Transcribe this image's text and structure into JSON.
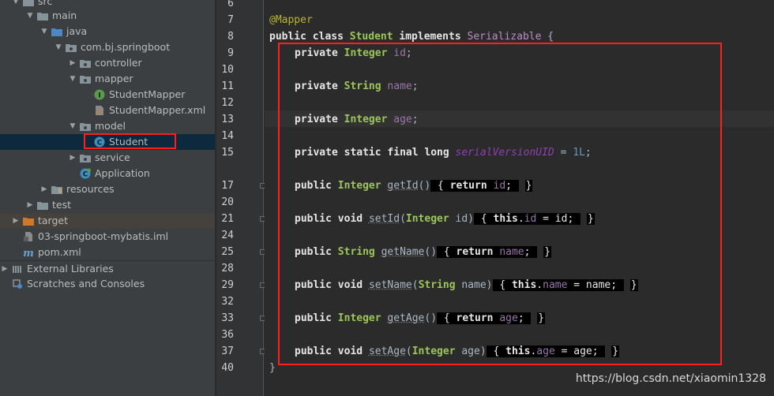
{
  "project_tree": {
    "items": [
      {
        "label": "src",
        "icon": "folder-icon",
        "arrow": "expanded"
      },
      {
        "label": "main",
        "icon": "folder-icon",
        "arrow": "expanded"
      },
      {
        "label": "java",
        "icon": "source-folder-icon",
        "arrow": "expanded"
      },
      {
        "label": "com.bj.springboot",
        "icon": "package-icon",
        "arrow": "expanded"
      },
      {
        "label": "controller",
        "icon": "package-icon",
        "arrow": "collapsed"
      },
      {
        "label": "mapper",
        "icon": "package-icon",
        "arrow": "expanded"
      },
      {
        "label": "StudentMapper",
        "icon": "interface-icon",
        "arrow": "none"
      },
      {
        "label": "StudentMapper.xml",
        "icon": "xml-file-icon",
        "arrow": "none"
      },
      {
        "label": "model",
        "icon": "package-icon",
        "arrow": "expanded"
      },
      {
        "label": "Student",
        "icon": "class-icon",
        "arrow": "none"
      },
      {
        "label": "service",
        "icon": "package-icon",
        "arrow": "collapsed"
      },
      {
        "label": "Application",
        "icon": "spring-boot-class-icon",
        "arrow": "none"
      },
      {
        "label": "resources",
        "icon": "resources-folder-icon",
        "arrow": "collapsed"
      },
      {
        "label": "test",
        "icon": "folder-icon",
        "arrow": "collapsed"
      },
      {
        "label": "target",
        "icon": "excluded-folder-icon",
        "arrow": "collapsed"
      },
      {
        "label": "03-springboot-mybatis.iml",
        "icon": "iml-file-icon",
        "arrow": "none"
      },
      {
        "label": "pom.xml",
        "icon": "maven-icon",
        "arrow": "none"
      },
      {
        "label": "External Libraries",
        "icon": "library-icon",
        "arrow": "collapsed"
      },
      {
        "label": "Scratches and Consoles",
        "icon": "scratches-icon",
        "arrow": "none"
      }
    ],
    "selected": "Student"
  },
  "editor": {
    "line_numbers": [
      "6",
      "7",
      "8",
      "9",
      "10",
      "11",
      "12",
      "13",
      "14",
      "15",
      "17",
      "20",
      "21",
      "24",
      "25",
      "28",
      "29",
      "32",
      "33",
      "36",
      "37",
      "40"
    ],
    "annotation": "@Mapper",
    "class_decl": {
      "k1": "public",
      "k2": "class",
      "name": "Student",
      "k3": "implements",
      "iface": "Serializable",
      "brace": "{"
    },
    "fields": [
      {
        "k1": "private",
        "type": "Integer",
        "name": "id",
        "end": ";"
      },
      {
        "k1": "private",
        "type": "String",
        "name": "name",
        "end": ";"
      },
      {
        "k1": "private",
        "type": "Integer",
        "name": "age",
        "end": ";"
      }
    ],
    "serial": {
      "k1": "private",
      "k2": "static",
      "k3": "final",
      "k4": "long",
      "name": "serialVersionUID",
      "eq": "=",
      "value": "1L",
      "end": ";"
    },
    "getters": [
      {
        "k1": "public",
        "type": "Integer",
        "method": "getId",
        "parens": "()",
        "open": "{",
        "ret": "return",
        "field": "id",
        "semi": ";",
        "close": "}"
      },
      {
        "k1": "public",
        "type": "String",
        "method": "getName",
        "parens": "()",
        "open": "{",
        "ret": "return",
        "field": "name",
        "semi": ";",
        "close": "}"
      },
      {
        "k1": "public",
        "type": "Integer",
        "method": "getAge",
        "parens": "()",
        "open": "{",
        "ret": "return",
        "field": "age",
        "semi": ";",
        "close": "}"
      }
    ],
    "setters": [
      {
        "k1": "public",
        "k2": "void",
        "method": "setId",
        "lp": "(",
        "ptype": "Integer",
        "param": "id",
        "rp": ")",
        "open": "{",
        "this": "this",
        "dot": ".",
        "field": "id",
        "eq": "=",
        "val": "id",
        "semi": ";",
        "close": "}"
      },
      {
        "k1": "public",
        "k2": "void",
        "method": "setName",
        "lp": "(",
        "ptype": "String",
        "param": "name",
        "rp": ")",
        "open": "{",
        "this": "this",
        "dot": ".",
        "field": "name",
        "eq": "=",
        "val": "name",
        "semi": ";",
        "close": "}"
      },
      {
        "k1": "public",
        "k2": "void",
        "method": "setAge",
        "lp": "(",
        "ptype": "Integer",
        "param": "age",
        "rp": ")",
        "open": "{",
        "this": "this",
        "dot": ".",
        "field": "age",
        "eq": "=",
        "val": "age",
        "semi": ";",
        "close": "}"
      }
    ],
    "class_close": "}"
  },
  "colors": {
    "highlight_box": "#ff1f1f",
    "keyword": "#e6e6e6",
    "type": "#9cc55a",
    "field": "#9876aa",
    "annotation": "#bbb529",
    "number": "#6897bb"
  },
  "watermark": "https://blog.csdn.net/xiaomin1328"
}
